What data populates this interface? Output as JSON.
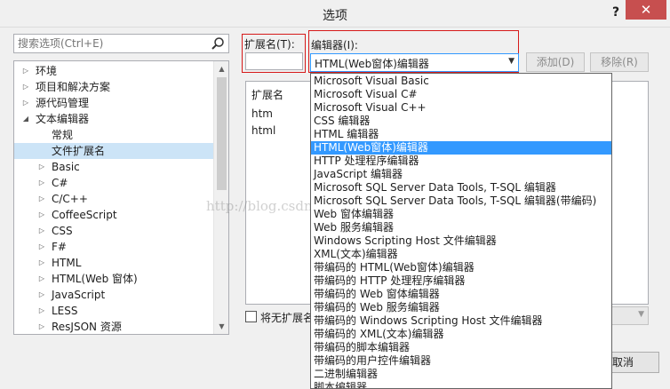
{
  "window": {
    "title": "选项",
    "help": "?",
    "close": "✕"
  },
  "search": {
    "placeholder": "搜索选项(Ctrl+E)"
  },
  "tree": {
    "items": [
      {
        "label": "环境",
        "level": 0,
        "arrow": "▷"
      },
      {
        "label": "项目和解决方案",
        "level": 0,
        "arrow": "▷"
      },
      {
        "label": "源代码管理",
        "level": 0,
        "arrow": "▷"
      },
      {
        "label": "文本编辑器",
        "level": 0,
        "arrow": "◢"
      },
      {
        "label": "常规",
        "level": 1,
        "arrow": ""
      },
      {
        "label": "文件扩展名",
        "level": 1,
        "arrow": "",
        "selected": true
      },
      {
        "label": "Basic",
        "level": 1,
        "arrow": "▷"
      },
      {
        "label": "C#",
        "level": 1,
        "arrow": "▷"
      },
      {
        "label": "C/C++",
        "level": 1,
        "arrow": "▷"
      },
      {
        "label": "CoffeeScript",
        "level": 1,
        "arrow": "▷"
      },
      {
        "label": "CSS",
        "level": 1,
        "arrow": "▷"
      },
      {
        "label": "F#",
        "level": 1,
        "arrow": "▷"
      },
      {
        "label": "HTML",
        "level": 1,
        "arrow": "▷"
      },
      {
        "label": "HTML(Web 窗体)",
        "level": 1,
        "arrow": "▷"
      },
      {
        "label": "JavaScript",
        "level": 1,
        "arrow": "▷"
      },
      {
        "label": "LESS",
        "level": 1,
        "arrow": "▷"
      },
      {
        "label": "ResJSON 资源",
        "level": 1,
        "arrow": "▷"
      }
    ]
  },
  "extension": {
    "label": "扩展名(T):",
    "value": ""
  },
  "editor": {
    "label": "编辑器(I):",
    "selected": "HTML(Web窗体)编辑器"
  },
  "buttons": {
    "add": "添加(D)",
    "remove": "移除(R)",
    "cancel": "取消"
  },
  "ext_list": {
    "header": "扩展名",
    "rows": [
      "htm",
      "html"
    ]
  },
  "no_ext": {
    "label": "将无扩展名"
  },
  "dropdown": {
    "options": [
      "Microsoft Visual Basic",
      "Microsoft Visual C#",
      "Microsoft Visual C++",
      "CSS 编辑器",
      "HTML 编辑器",
      "HTML(Web窗体)编辑器",
      "HTTP 处理程序编辑器",
      "JavaScript 编辑器",
      "Microsoft SQL Server Data Tools, T-SQL 编辑器",
      "Microsoft SQL Server Data Tools, T-SQL 编辑器(带编码)",
      "Web 窗体编辑器",
      "Web 服务编辑器",
      "Windows Scripting Host 文件编辑器",
      "XML(文本)编辑器",
      "带编码的 HTML(Web窗体)编辑器",
      "带编码的 HTTP 处理程序编辑器",
      "带编码的 Web 窗体编辑器",
      "带编码的 Web 服务编辑器",
      "带编码的 Windows Scripting Host 文件编辑器",
      "带编码的 XML(文本)编辑器",
      "带编码的脚本编辑器",
      "带编码的用户控件编辑器",
      "二进制编辑器",
      "脚本编辑器"
    ],
    "selected_index": 5
  },
  "watermark": "http://blog.csdn.net/",
  "colors": {
    "highlight": "#3399ff",
    "annotation": "#d61a1a",
    "tree_selection": "#cce4f7"
  }
}
